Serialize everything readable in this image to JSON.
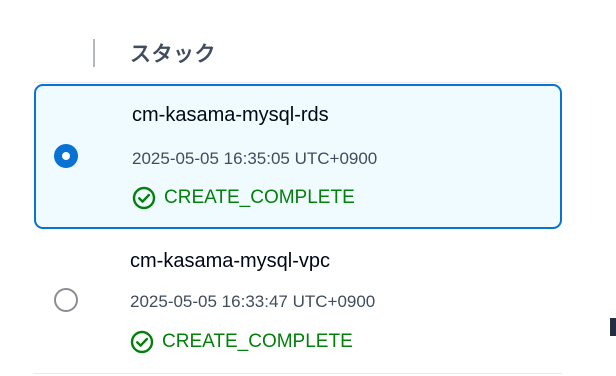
{
  "header": {
    "title": "スタック"
  },
  "stacks": [
    {
      "name": "cm-kasama-mysql-rds",
      "created": "2025-05-05 16:35:05 UTC+0900",
      "status": "CREATE_COMPLETE",
      "selected": true
    },
    {
      "name": "cm-kasama-mysql-vpc",
      "created": "2025-05-05 16:33:47 UTC+0900",
      "status": "CREATE_COMPLETE",
      "selected": false
    }
  ],
  "colors": {
    "accent": "#0972d3",
    "selected_bg": "#f0fbff",
    "success": "#037f0c",
    "text": "#000716",
    "muted": "#414d5c"
  },
  "icons": {
    "status": "check-circle-icon",
    "selected_radio": "radio-checked-icon",
    "unselected_radio": "radio-unchecked-icon"
  }
}
